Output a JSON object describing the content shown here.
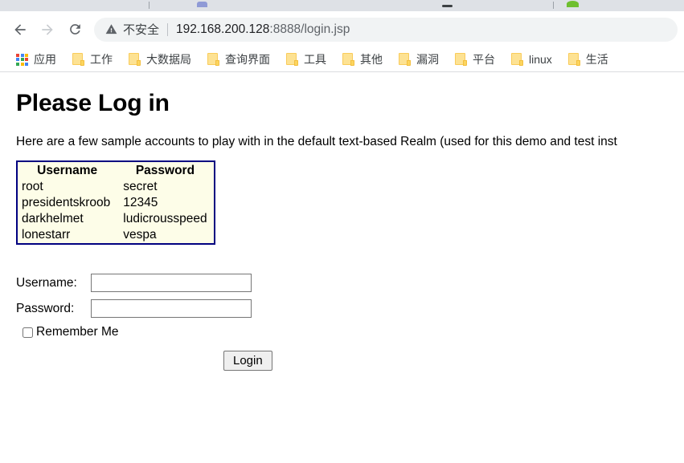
{
  "browser": {
    "nav": {
      "back_icon": "back-arrow-icon",
      "forward_icon": "forward-arrow-icon",
      "reload_icon": "reload-icon"
    },
    "omnibox": {
      "security_warning_icon": "warning-triangle-icon",
      "security_label": "不安全",
      "url_host": "192.168.200.128",
      "url_rest": ":8888/login.jsp",
      "full_url": "192.168.200.128:8888/login.jsp"
    },
    "bookmarks": {
      "apps_icon": "apps-grid-icon",
      "apps_label": "应用",
      "items": [
        {
          "icon": "folder-icon",
          "label": "工作"
        },
        {
          "icon": "folder-icon",
          "label": "大数据局"
        },
        {
          "icon": "folder-icon",
          "label": "查询界面"
        },
        {
          "icon": "folder-icon",
          "label": "工具"
        },
        {
          "icon": "folder-icon",
          "label": "其他"
        },
        {
          "icon": "folder-icon",
          "label": "漏洞"
        },
        {
          "icon": "folder-icon",
          "label": "平台"
        },
        {
          "icon": "folder-icon",
          "label": "linux"
        },
        {
          "icon": "folder-icon",
          "label": "生活"
        }
      ]
    }
  },
  "page": {
    "title": "Please Log in",
    "intro": "Here are a few sample accounts to play with in the default text-based Realm (used for this demo and test inst",
    "accounts_table": {
      "headers": [
        "Username",
        "Password"
      ],
      "rows": [
        [
          "root",
          "secret"
        ],
        [
          "presidentskroob",
          "12345"
        ],
        [
          "darkhelmet",
          "ludicrousspeed"
        ],
        [
          "lonestarr",
          "vespa"
        ]
      ]
    },
    "form": {
      "username_label": "Username:",
      "username_value": "",
      "password_label": "Password:",
      "password_value": "",
      "remember_label": "Remember Me",
      "remember_checked": false,
      "login_button": "Login"
    }
  },
  "colors": {
    "table_border": "#000080",
    "table_background": "#fdfde8",
    "chrome_tab_background": "#dee1e6",
    "omnibox_background": "#f1f3f4",
    "folder_yellow": "#fde293"
  }
}
